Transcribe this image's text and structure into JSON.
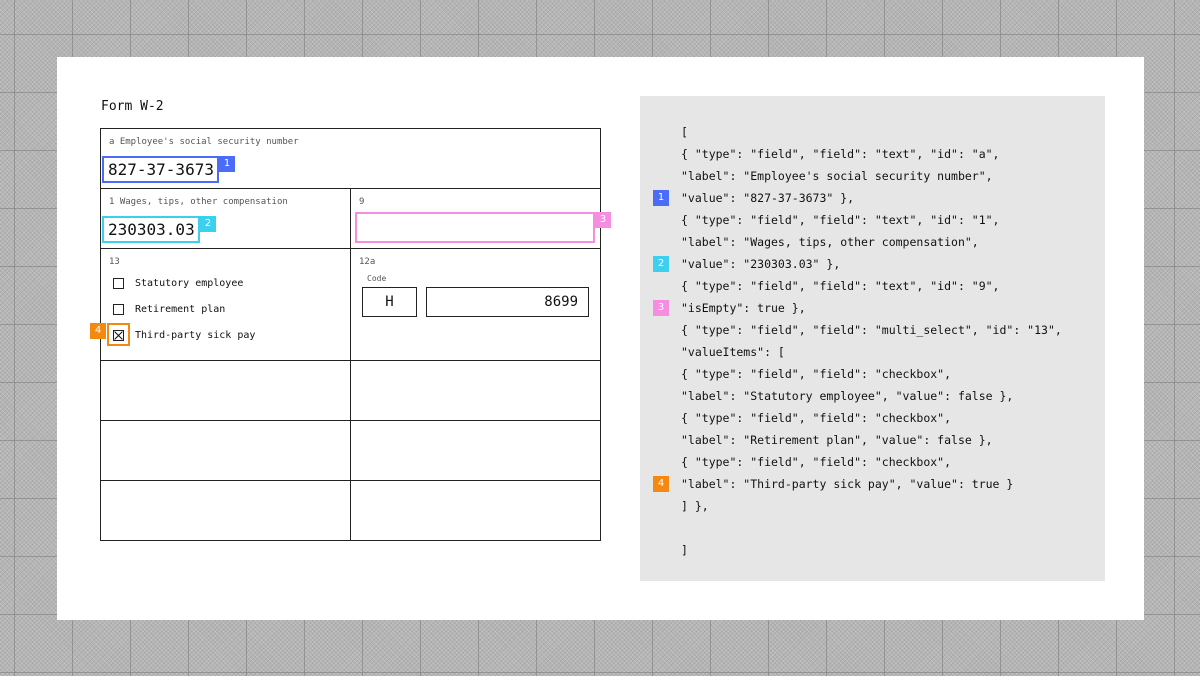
{
  "form": {
    "title": "Form W-2",
    "ssn": {
      "label": "a Employee's social security number",
      "value": "827-37-3673",
      "badge": "1"
    },
    "wages": {
      "label": "1 Wages, tips, other compensation",
      "value": "230303.03",
      "badge": "2"
    },
    "box9": {
      "label": "9",
      "value": "",
      "badge": "3"
    },
    "box13": {
      "label": "13",
      "items": [
        {
          "label": "Statutory employee",
          "checked": false
        },
        {
          "label": "Retirement plan",
          "checked": false
        },
        {
          "label": "Third-party sick pay",
          "checked": true,
          "badge": "4"
        }
      ]
    },
    "box12a": {
      "label": "12a",
      "code_label": "Code",
      "code": "H",
      "amount": "8699"
    }
  },
  "json_lines": [
    {
      "text": "["
    },
    {
      "text": "{ \"type\": \"field\", \"field\": \"text\", \"id\": \"a\","
    },
    {
      "text": "\"label\": \"Employee's social security number\","
    },
    {
      "text": "\"value\": \"827-37-3673\" },",
      "badge": "1"
    },
    {
      "text": "{ \"type\": \"field\", \"field\": \"text\", \"id\": \"1\","
    },
    {
      "text": "\"label\": \"Wages, tips, other compensation\","
    },
    {
      "text": "\"value\": \"230303.03\" },",
      "badge": "2"
    },
    {
      "text": "{ \"type\": \"field\", \"field\": \"text\", \"id\": \"9\","
    },
    {
      "text": "\"isEmpty\": true },",
      "badge": "3"
    },
    {
      "text": "{ \"type\": \"field\", \"field\": \"multi_select\", \"id\": \"13\","
    },
    {
      "text": "\"valueItems\": ["
    },
    {
      "text": "{ \"type\": \"field\", \"field\": \"checkbox\","
    },
    {
      "text": "\"label\": \"Statutory employee\", \"value\": false },"
    },
    {
      "text": "{ \"type\": \"field\", \"field\": \"checkbox\","
    },
    {
      "text": "\"label\": \"Retirement plan\", \"value\": false },"
    },
    {
      "text": "{ \"type\": \"field\", \"field\": \"checkbox\","
    },
    {
      "text": "\"label\": \"Third-party sick pay\", \"value\": true }",
      "badge": "4"
    },
    {
      "text": "] },"
    },
    {
      "text": ""
    },
    {
      "text": "]"
    }
  ],
  "colors": {
    "badge_1": "#4a6cf7",
    "badge_2": "#3ccfee",
    "badge_3": "#f58ee0",
    "badge_4": "#f5890f"
  }
}
